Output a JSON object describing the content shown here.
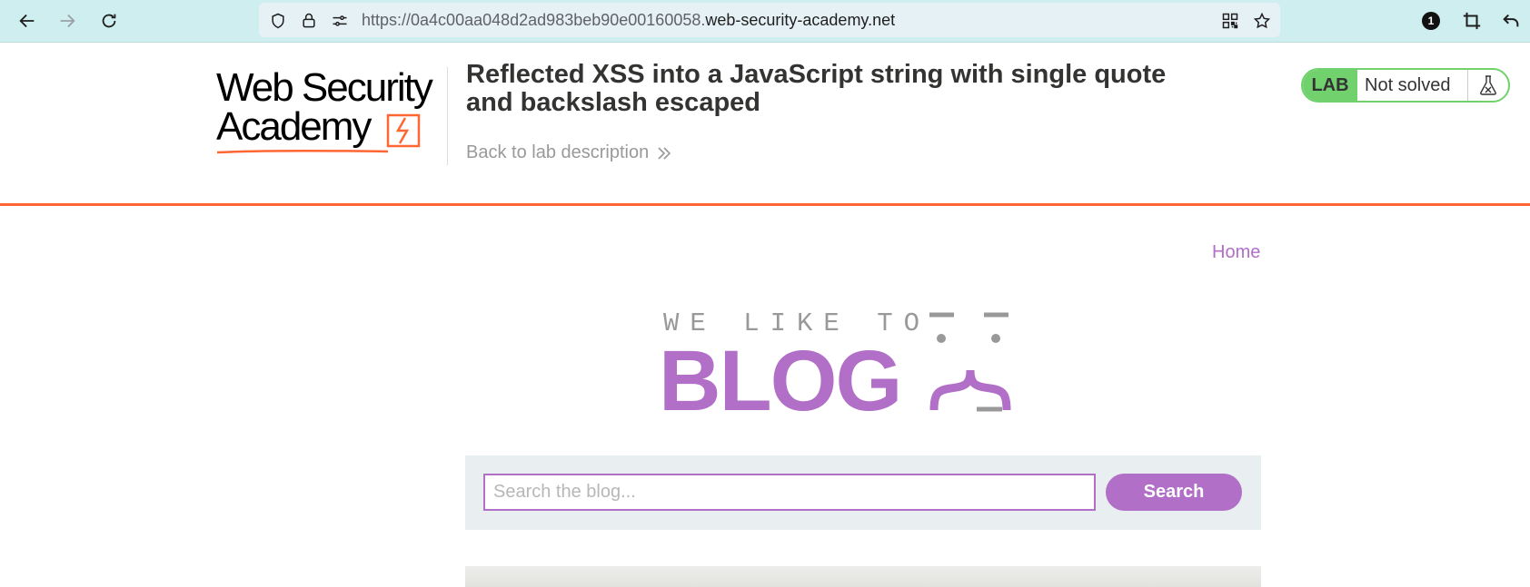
{
  "browser": {
    "url_prefix": "https://0a4c00aa048d2ad983beb90e00160058.",
    "url_host": "web-security-academy.net",
    "icons": [
      "back-arrow-icon",
      "forward-arrow-icon",
      "reload-icon",
      "shield-icon",
      "lock-icon",
      "site-settings-icon",
      "qr-code-icon",
      "star-icon",
      "extension-badge-icon",
      "crop-icon",
      "undo-icon"
    ],
    "extension_badge_count": "1"
  },
  "academy": {
    "logo_line1": "Web Security",
    "logo_line2": "Academy",
    "lab_title": "Reflected XSS into a JavaScript string with single quote and backslash escaped",
    "back_link": "Back to lab description",
    "lab_label": "LAB",
    "lab_status": "Not solved",
    "accent_color": "#ff6633",
    "status_color": "#70d16d"
  },
  "blog": {
    "nav_home": "Home",
    "banner_tagline": "WE LIKE TO",
    "banner_title": "BLOG",
    "search_placeholder": "Search the blog...",
    "search_value": "",
    "search_button": "Search",
    "brand_color": "#b16fc7"
  }
}
